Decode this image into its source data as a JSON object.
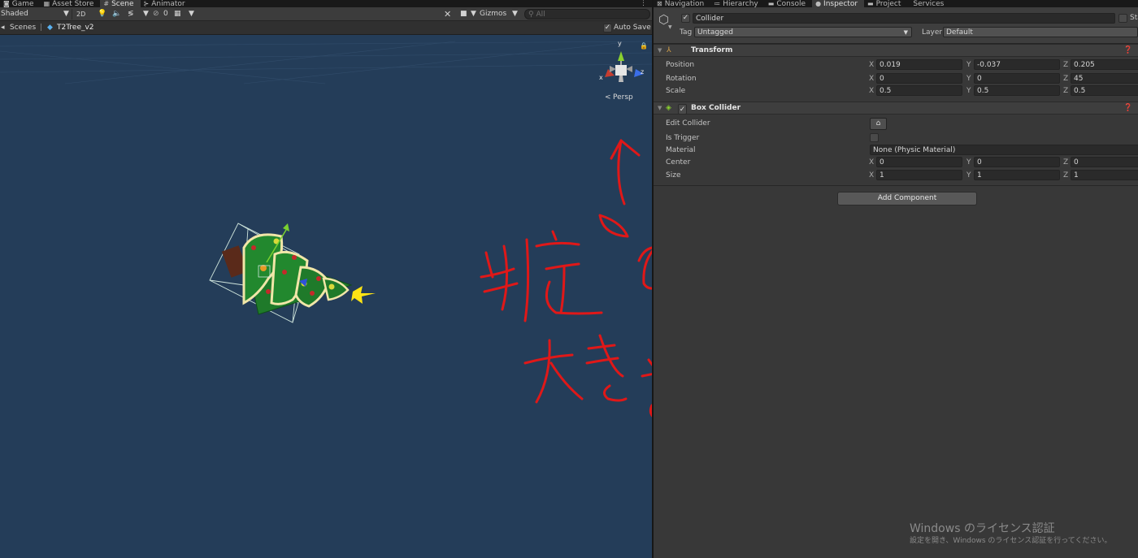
{
  "left_tabs": [
    {
      "label": "Game",
      "icon": "gamepad-icon"
    },
    {
      "label": "Asset Store",
      "icon": "store-icon"
    },
    {
      "label": "Scene",
      "icon": "grid-icon",
      "active": true
    },
    {
      "label": "Animator",
      "icon": "animator-icon"
    }
  ],
  "scene_toolbar": {
    "shading_mode": "Shaded",
    "mode_2d": "2D",
    "hidden_count": "0",
    "gizmos_label": "Gizmos",
    "search_placeholder": "All"
  },
  "breadcrumb": {
    "root": "Scenes",
    "prefab": "T2Tree_v2",
    "auto_save_label": "Auto Save",
    "auto_save_checked": true
  },
  "orientation_gizmo": {
    "y": "y",
    "x": "x",
    "z": "z",
    "projection": "Persp"
  },
  "annotation_text": "判定の大きさ",
  "right_tabs": [
    {
      "label": "Navigation",
      "icon": "navigation-icon"
    },
    {
      "label": "Hierarchy",
      "icon": "hierarchy-icon"
    },
    {
      "label": "Console",
      "icon": "console-icon"
    },
    {
      "label": "Inspector",
      "icon": "info-icon",
      "active": true
    },
    {
      "label": "Project",
      "icon": "folder-icon"
    },
    {
      "label": "Services",
      "icon": "cloud-icon"
    }
  ],
  "inspector": {
    "object_name": "Collider",
    "active": true,
    "static_label": "Sta",
    "tag_label": "Tag",
    "tag_value": "Untagged",
    "layer_label": "Layer",
    "layer_value": "Default",
    "transform": {
      "title": "Transform",
      "position_label": "Position",
      "rotation_label": "Rotation",
      "scale_label": "Scale",
      "position": {
        "x": "0.019",
        "y": "-0.037",
        "z": "0.205"
      },
      "rotation": {
        "x": "0",
        "y": "0",
        "z": "45"
      },
      "scale": {
        "x": "0.5",
        "y": "0.5",
        "z": "0.5"
      }
    },
    "box_collider": {
      "title": "Box Collider",
      "enabled": true,
      "edit_collider_label": "Edit Collider",
      "is_trigger_label": "Is Trigger",
      "is_trigger": false,
      "material_label": "Material",
      "material_value": "None (Physic Material)",
      "center_label": "Center",
      "size_label": "Size",
      "center": {
        "x": "0",
        "y": "0",
        "z": "0"
      },
      "size": {
        "x": "1",
        "y": "1",
        "z": "1"
      }
    },
    "add_component_label": "Add Component"
  },
  "watermark": {
    "title": "Windows のライセンス認証",
    "subtitle": "設定を開き、Windows のライセンス認証を行ってください。"
  },
  "colors": {
    "scene_bg": "#243d59",
    "panel_bg": "#383838",
    "annotation_red": "#e01818",
    "axis_x": "#c63c2f",
    "axis_y": "#8ad12f",
    "axis_z": "#3b6ee8"
  }
}
